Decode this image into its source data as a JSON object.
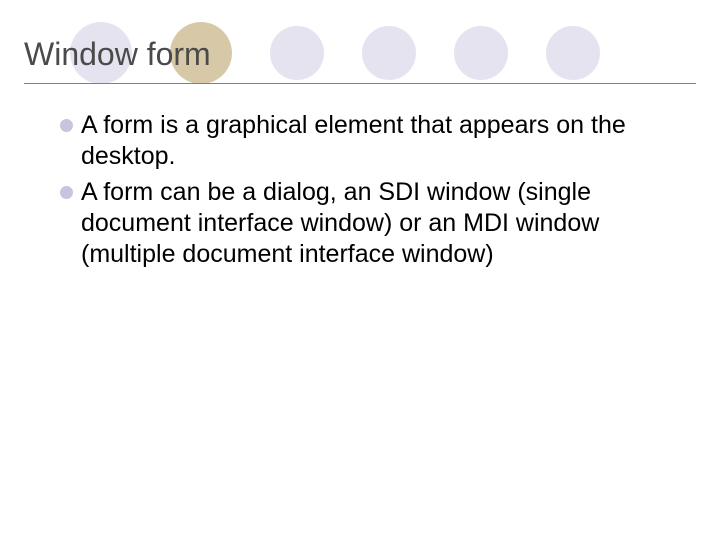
{
  "slide": {
    "title": "Window form",
    "bullets": [
      "A form is a graphical element that appears on the desktop.",
      "A form can be a dialog, an SDI window (single document interface window) or an MDI window (multiple document interface window)"
    ]
  }
}
